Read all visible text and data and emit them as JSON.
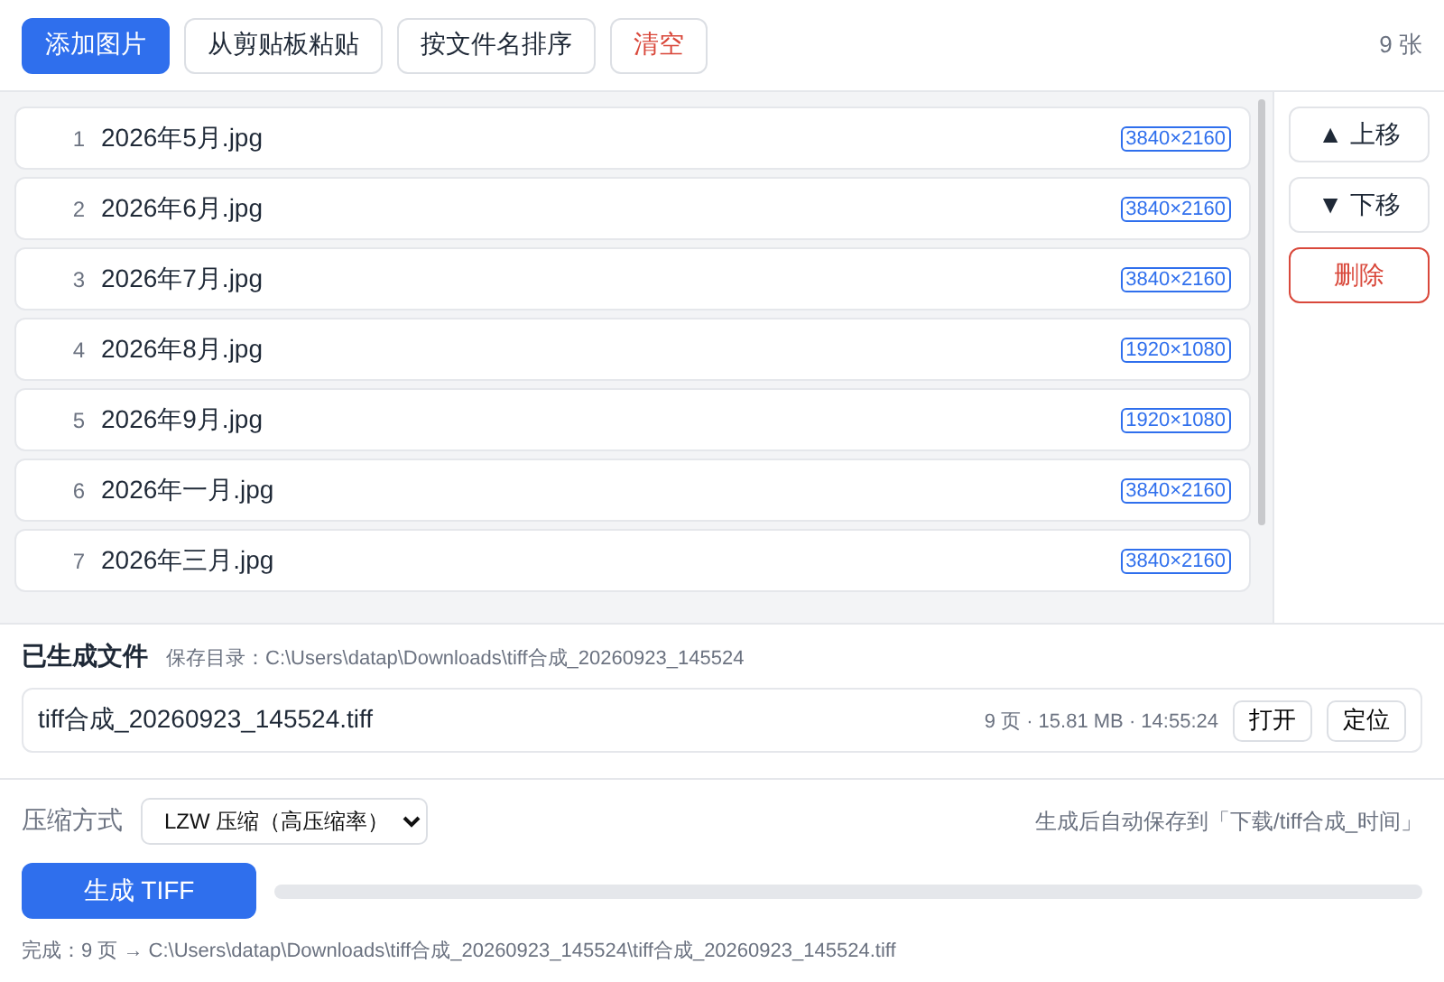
{
  "toolbar": {
    "buttons": [
      {
        "label": "添加图片",
        "kind": "primary"
      },
      {
        "label": "从剪贴板粘贴",
        "kind": "plain"
      },
      {
        "label": "按文件名排序",
        "kind": "plain"
      },
      {
        "label": "清空",
        "kind": "danger"
      }
    ],
    "count": "9 张"
  },
  "images": [
    {
      "index": "1",
      "name": "2026年5月.jpg",
      "size": "3840×2160"
    },
    {
      "index": "2",
      "name": "2026年6月.jpg",
      "size": "3840×2160"
    },
    {
      "index": "3",
      "name": "2026年7月.jpg",
      "size": "3840×2160"
    },
    {
      "index": "4",
      "name": "2026年8月.jpg",
      "size": "1920×1080"
    },
    {
      "index": "5",
      "name": "2026年9月.jpg",
      "size": "1920×1080"
    },
    {
      "index": "6",
      "name": "2026年一月.jpg",
      "size": "3840×2160"
    },
    {
      "index": "7",
      "name": "2026年三月.jpg",
      "size": "3840×2160"
    }
  ],
  "side_buttons": [
    {
      "label": "▲ 上移",
      "kind": "plain"
    },
    {
      "label": "▼ 下移",
      "kind": "plain"
    },
    {
      "label": "删除",
      "kind": "danger"
    }
  ],
  "output": {
    "title": "已生成文件",
    "directory": "保存目录：C:\\Users\\datap\\Downloads\\tiff合成_20260923_145524",
    "file": {
      "name": "tiff合成_20260923_145524.tiff",
      "meta": "9 页 · 15.81 MB · 14:55:24",
      "actions": [
        "打开",
        "定位"
      ]
    }
  },
  "settings": {
    "compression_label": "压缩方式",
    "compression_value": "LZW 压缩（高压缩率）",
    "save_hint": "生成后自动保存到「下载/tiff合成_时间」"
  },
  "generate": {
    "label": "生成 TIFF",
    "progress": {
      "level": 0
    }
  },
  "status": "完成：9 页 → C:\\Users\\datap\\Downloads\\tiff合成_20260923_145524\\tiff合成_20260923_145524.tiff"
}
